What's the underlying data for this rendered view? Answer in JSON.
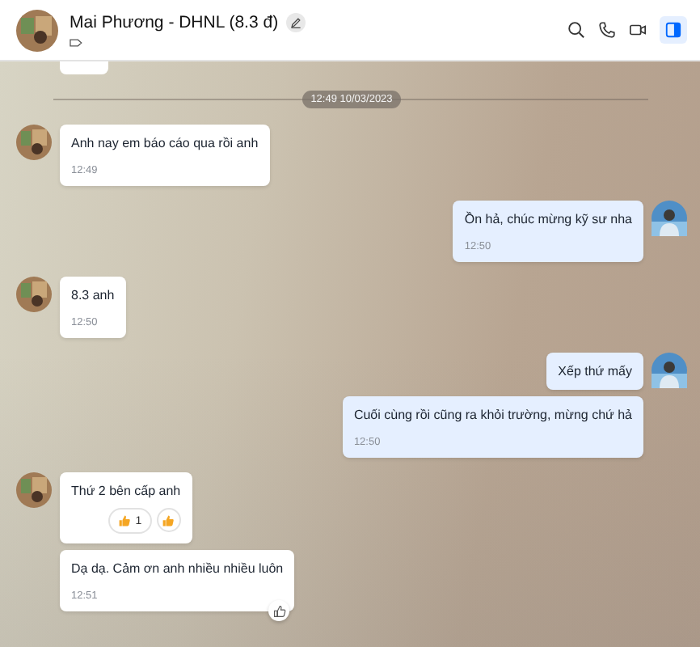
{
  "header": {
    "title": "Mai Phương - DHNL (8.3 đ)",
    "info_panel_button": {
      "selected": true
    }
  },
  "date_divider": "12:49 10/03/2023",
  "messages": [
    {
      "kind": "incoming",
      "avatar": true,
      "text": "Anh nay em báo cáo qua rồi anh",
      "time": "12:49"
    },
    {
      "kind": "outgoing",
      "avatar": true,
      "text": "Ồn hả, chúc mừng kỹ sư nha",
      "time": "12:50"
    },
    {
      "kind": "incoming",
      "avatar": true,
      "text": "8.3 anh",
      "time": "12:50"
    },
    {
      "kind": "outgoing",
      "avatar": true,
      "text": "Xếp thứ mấy"
    },
    {
      "kind": "outgoing",
      "avatar": false,
      "text": "Cuối cùng rồi cũng ra khỏi trường, mừng chứ hả",
      "time": "12:50"
    },
    {
      "kind": "incoming",
      "avatar": true,
      "text": "Thứ 2 bên cấp anh",
      "reactions": [
        {
          "count": "1"
        }
      ],
      "add_reaction": true
    },
    {
      "kind": "incoming",
      "avatar": false,
      "text": "Dạ dạ. Cảm ơn anh nhiều nhiều luôn",
      "time": "12:51",
      "like_button": true
    }
  ]
}
